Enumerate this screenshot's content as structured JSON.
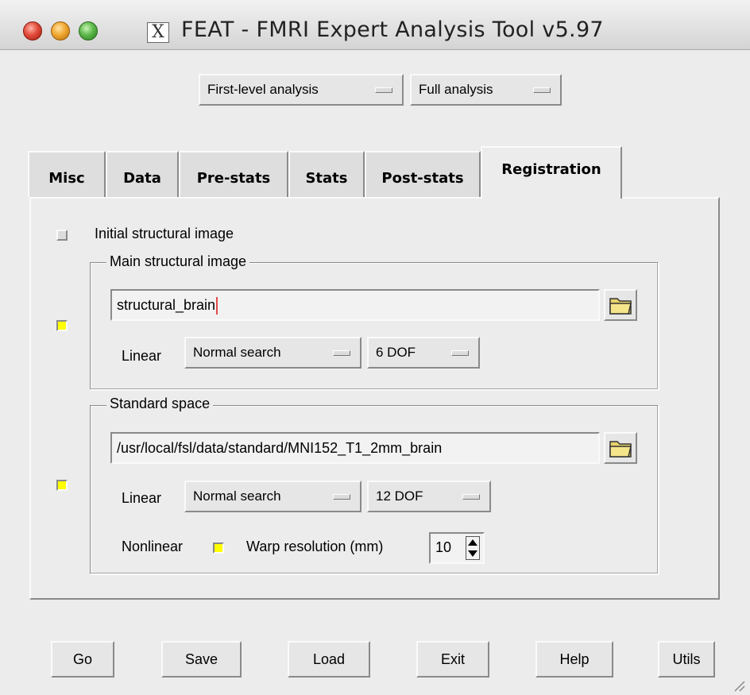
{
  "window": {
    "title": "FEAT - FMRI Expert Analysis Tool v5.97"
  },
  "top_menus": {
    "analysis_level": "First-level analysis",
    "analysis_type": "Full analysis"
  },
  "tabs": [
    {
      "label": "Misc"
    },
    {
      "label": "Data"
    },
    {
      "label": "Pre-stats"
    },
    {
      "label": "Stats"
    },
    {
      "label": "Post-stats"
    },
    {
      "label": "Registration"
    }
  ],
  "registration": {
    "initial_structural": {
      "label": "Initial structural image",
      "checked": false
    },
    "main_structural": {
      "title": "Main structural image",
      "checked": true,
      "path": "structural_brain",
      "linear_label": "Linear",
      "search": "Normal search",
      "dof": "6 DOF"
    },
    "standard_space": {
      "title": "Standard space",
      "checked": true,
      "path": "/usr/local/fsl/data/standard/MNI152_T1_2mm_brain",
      "linear_label": "Linear",
      "search": "Normal search",
      "dof": "12 DOF",
      "nonlinear_label": "Nonlinear",
      "nonlinear_checked": true,
      "warp_label": "Warp resolution (mm)",
      "warp_value": "10"
    }
  },
  "buttons": {
    "go": "Go",
    "save": "Save",
    "load": "Load",
    "exit": "Exit",
    "help": "Help",
    "utils": "Utils"
  },
  "colors": {
    "checked": "#ffff00",
    "background": "#ececec"
  }
}
